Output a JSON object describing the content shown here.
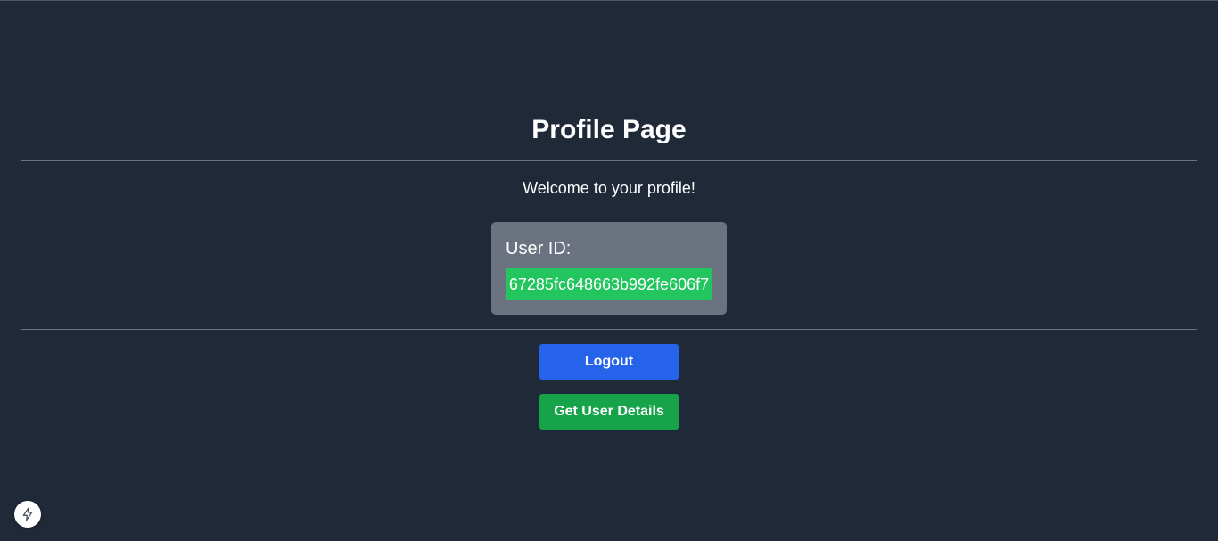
{
  "page": {
    "title": "Profile Page",
    "welcome": "Welcome to your profile!"
  },
  "user_card": {
    "label": "User ID:",
    "user_id": "67285fc648663b992fe606f7"
  },
  "actions": {
    "logout_label": "Logout",
    "details_label": "Get User Details"
  },
  "dev_indicator": {
    "icon": "lightning-bolt-icon"
  },
  "colors": {
    "background": "#1f2937",
    "card": "#6b7280",
    "id_highlight": "#22c55e",
    "logout_button": "#2563eb",
    "details_button": "#16a34a",
    "divider": "#6b7280"
  }
}
